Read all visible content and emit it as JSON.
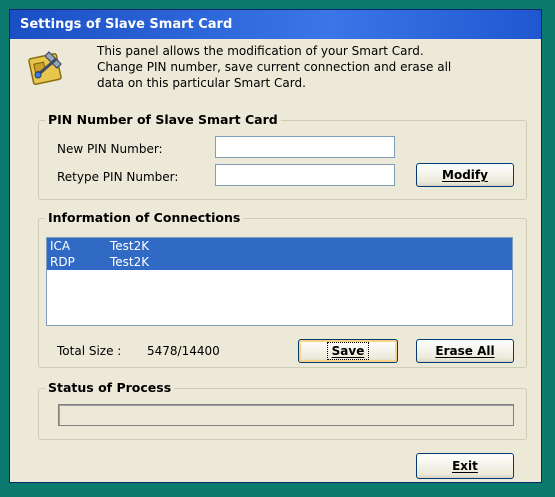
{
  "window": {
    "title": "Settings of Slave Smart Card"
  },
  "intro": {
    "icon": "smart-card-tools-icon",
    "line1": "This panel allows the modification of your Smart Card.",
    "line2": "Change PIN number, save current connection and erase all",
    "line3": "data on this particular Smart Card."
  },
  "pin_group": {
    "title": "PIN Number of Slave Smart Card",
    "new_pin_label": "New PIN Number:",
    "new_pin_value": "",
    "retype_pin_label": "Retype PIN Number:",
    "retype_pin_value": "",
    "modify_button": "Modify"
  },
  "connections_group": {
    "title": "Information of Connections",
    "rows": [
      {
        "type": "ICA",
        "name": "Test2K"
      },
      {
        "type": "RDP",
        "name": "Test2K"
      }
    ],
    "total_size_label": "Total Size :",
    "total_size_value": "5478/14400",
    "save_button": "Save",
    "erase_button": "Erase All"
  },
  "status_group": {
    "title": "Status of Process",
    "progress": 0
  },
  "exit_button": "Exit",
  "colors": {
    "titlebar": "#2a63dc",
    "selection": "#316ac5",
    "desktop": "#0b7b6f"
  }
}
